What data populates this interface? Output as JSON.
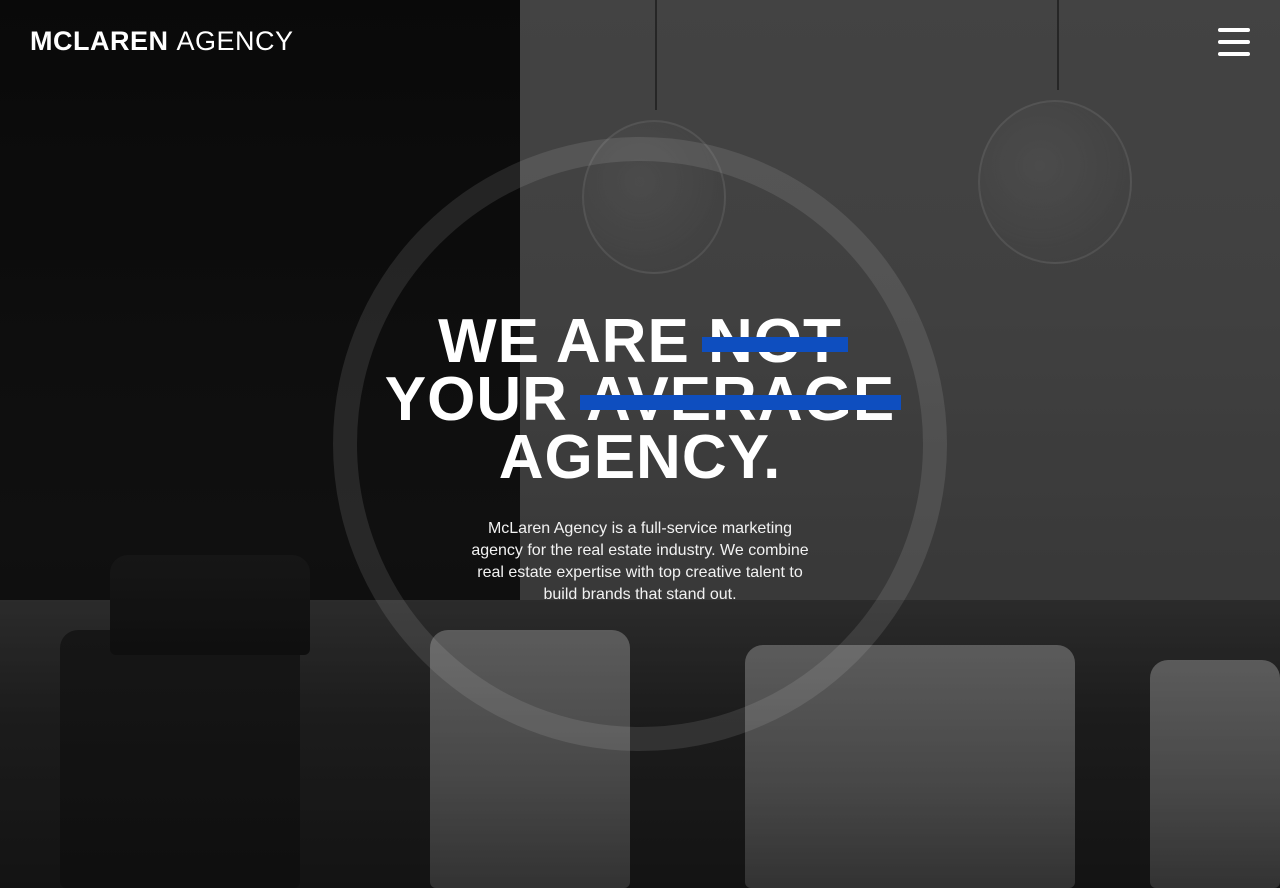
{
  "header": {
    "logo_strong": "MCLAREN",
    "logo_light": "AGENCY",
    "menu_icon": "hamburger-menu-icon"
  },
  "hero": {
    "headline": {
      "line1_plain": "WE ARE",
      "line1_struck": "NOT",
      "line2_plain": "YOUR",
      "line2_struck": "AVERAGE",
      "line3": "AGENCY."
    },
    "description": "McLaren Agency is a full-service marketing agency for the real estate industry. We combine real estate expertise with top creative talent to build brands that stand out."
  },
  "colors": {
    "strike_accent": "#0e4ebf",
    "text": "#ffffff"
  }
}
